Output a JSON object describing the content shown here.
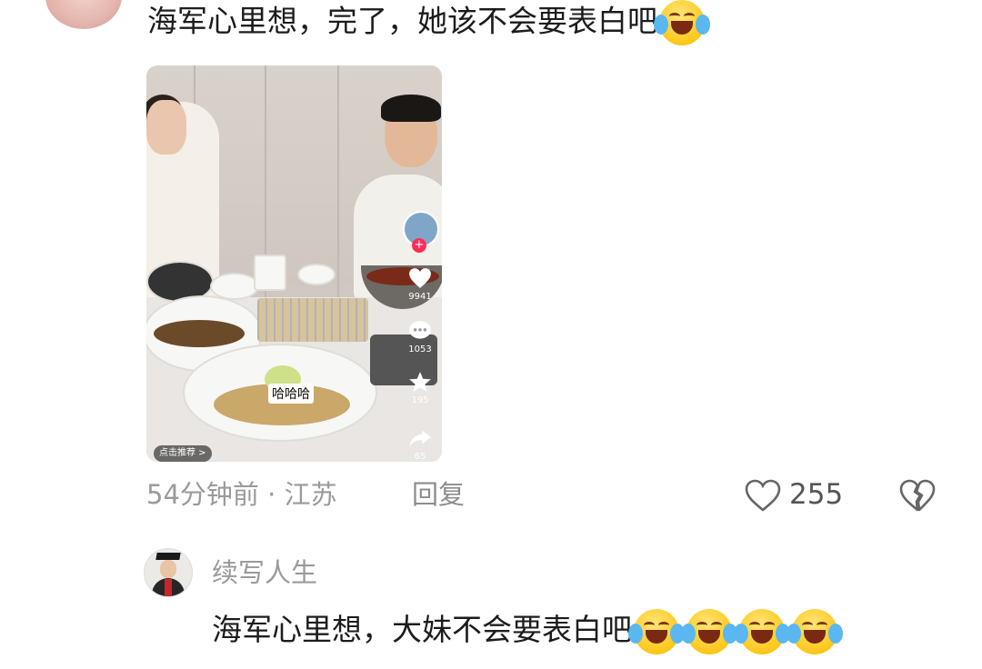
{
  "comment": {
    "text": "海军心里想，完了，她该不会要表白吧",
    "emoji_icon": "laughing-crying-emoji",
    "video": {
      "likes": "9941",
      "comments": "1053",
      "favorites": "195",
      "shares": "65",
      "caption": "哈哈哈",
      "recommend_label": "点击推荐 >"
    },
    "time": "54分钟前",
    "separator": "·",
    "location": "江苏",
    "reply_label": "回复",
    "like_count": "255",
    "colors": {
      "emoji_yellow": "#ffc81a",
      "accent_red": "#ff2c55"
    }
  },
  "reply": {
    "username": "续写人生",
    "text": "海军心里想，大妹不会要表白吧",
    "emoji_count": 4
  }
}
